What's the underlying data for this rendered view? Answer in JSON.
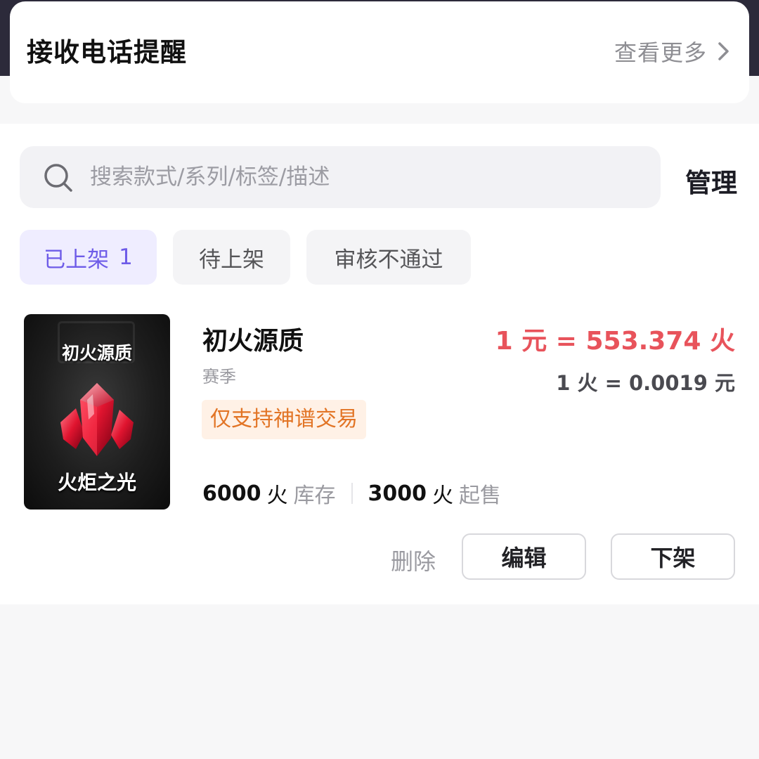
{
  "notice": {
    "title": "接收电话提醒",
    "more_label": "查看更多",
    "more_icon": "chevron-right-icon"
  },
  "search": {
    "icon": "search-icon",
    "placeholder": "搜索款式/系列/标签/描述",
    "value": ""
  },
  "manage_label": "管理",
  "tabs": [
    {
      "label": "已上架",
      "count": "1",
      "active": true
    },
    {
      "label": "待上架",
      "count": "",
      "active": false
    },
    {
      "label": "审核不通过",
      "count": "",
      "active": false
    }
  ],
  "product": {
    "thumbnail": {
      "top_text": "初火源质",
      "bottom_text": "火炬之光",
      "icon": "red-crystal-icon"
    },
    "name": "初火源质",
    "subtitle": "赛季",
    "tag": "仅支持神谱交易",
    "rate_main": "1 元 = 553.374 火",
    "rate_sub": "1 火 = 0.0019 元",
    "stock": {
      "value": "6000",
      "unit": "火",
      "label": "库存"
    },
    "min_sale": {
      "value": "3000",
      "unit": "火",
      "label": "起售"
    }
  },
  "actions": {
    "delete_label": "删除",
    "edit_label": "编辑",
    "unlist_label": "下架"
  },
  "colors": {
    "accent_purple": "#6e5ce8",
    "price_red": "#e8535b",
    "tag_orange": "#e27425",
    "tag_bg": "#fff1e6"
  }
}
